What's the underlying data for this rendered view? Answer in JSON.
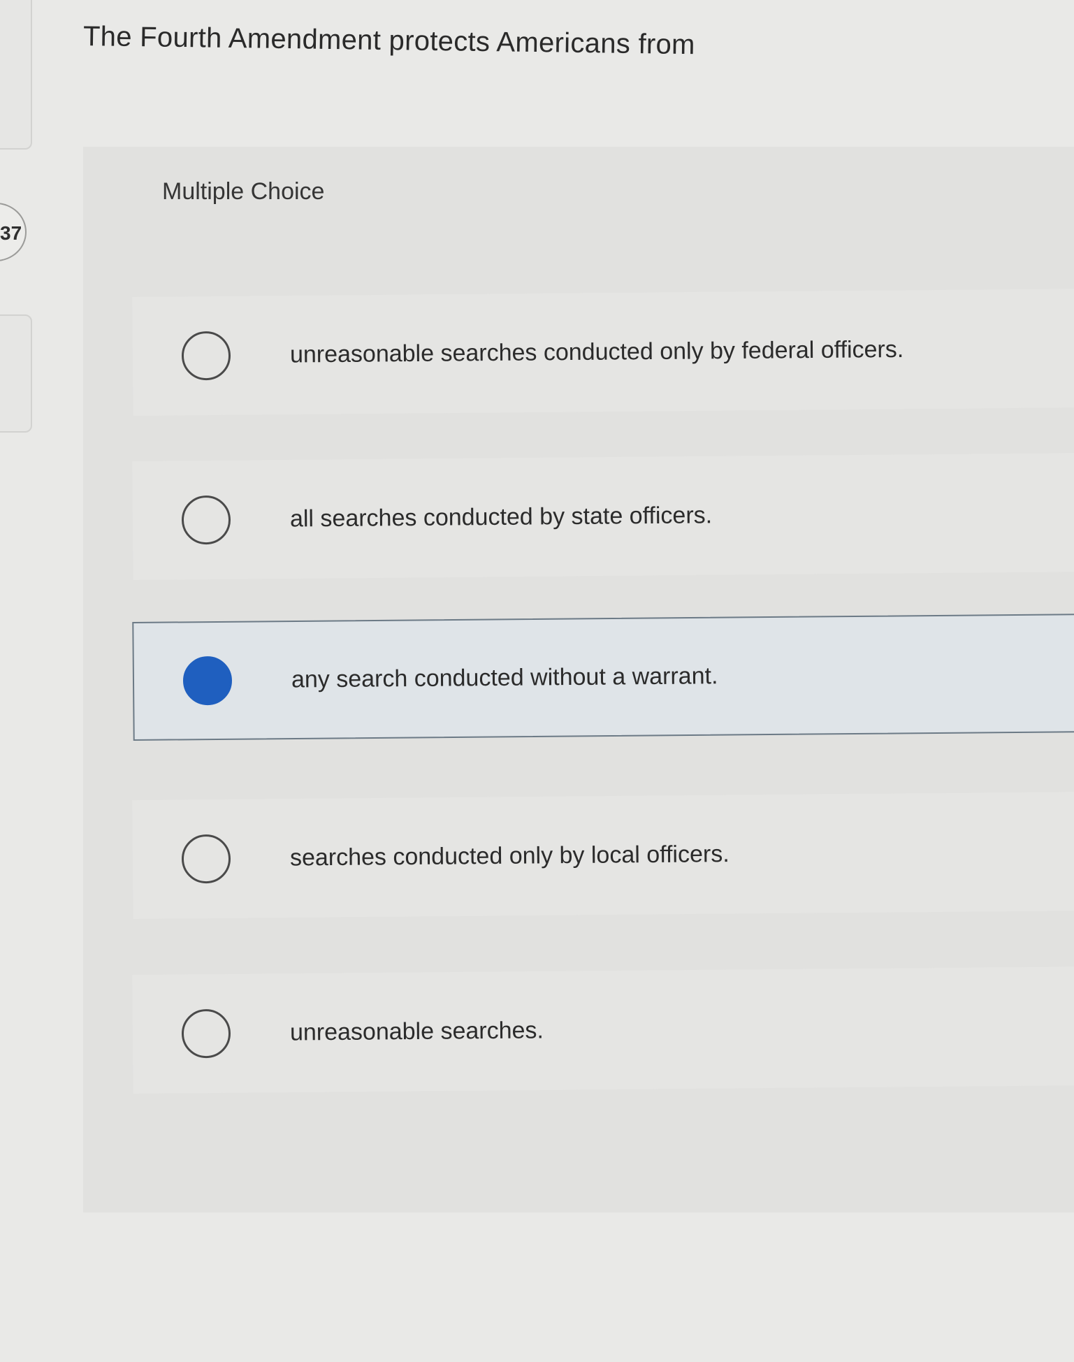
{
  "question": {
    "number": "37",
    "prompt": "The Fourth Amendment protects Americans from",
    "type_label": "Multiple Choice"
  },
  "choices": [
    {
      "label": "unreasonable searches conducted only by federal officers.",
      "selected": false
    },
    {
      "label": "all searches conducted by state officers.",
      "selected": false
    },
    {
      "label": "any search conducted without a warrant.",
      "selected": true
    },
    {
      "label": "searches conducted only by local officers.",
      "selected": false
    },
    {
      "label": "unreasonable searches.",
      "selected": false
    }
  ],
  "colors": {
    "selected_radio": "#1f5fbf",
    "selected_border": "#6c7a86"
  }
}
